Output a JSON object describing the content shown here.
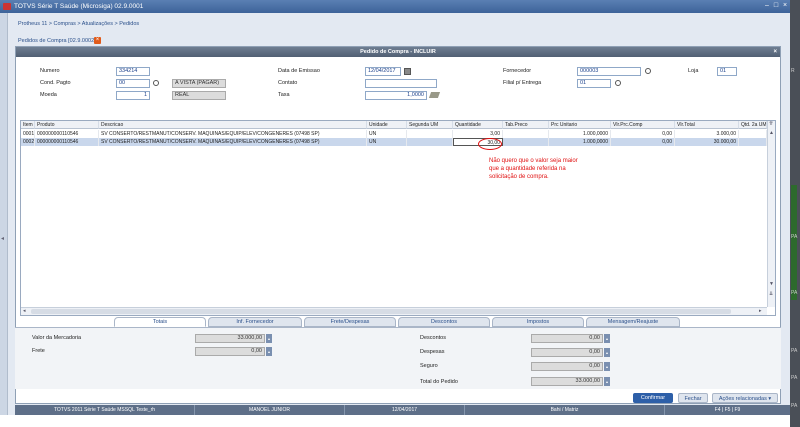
{
  "window": {
    "title": "TOTVS Série T Saúde (Microsiga) 02.9.0001"
  },
  "breadcrumb": "Protheus 11 > Compras > Atualizações > Pedidos",
  "page_title": "Pedidos de Compra [02.9.0002]",
  "dialog": {
    "title": "Pedido de Compra - INCLUIR"
  },
  "header": {
    "numero_label": "Numero",
    "numero": "334214",
    "cond_label": "Cond. Pagto",
    "cond": "00",
    "cond_desc": "A VISTA (PAGAR)",
    "moeda_label": "Moeda",
    "moeda": "1",
    "moeda_desc": "REAL",
    "data_label": "Data de Emissao",
    "data": "12/04/2017",
    "contato_label": "Contato",
    "contato": "",
    "taxa_label": "Taxa",
    "taxa": "1,0000",
    "fornecedor_label": "Fornecedor",
    "fornecedor": "000003",
    "loja_label": "Loja",
    "loja": "01",
    "filial_label": "Filial p/ Entrega",
    "filial": "01"
  },
  "grid": {
    "columns": [
      "Item",
      "Produto",
      "Descricao",
      "Unidade",
      "Segunda UM",
      "Quantidade",
      "Tab.Preco",
      "Prc Unitario",
      "Vlr.Prc.Comp",
      "Vlr.Total",
      "Qtd. 2a UM"
    ],
    "rows": [
      [
        "0001",
        "000000000110546",
        "SV CONSERTO/RESTMANUT/CONSERV. MAQUINAS/EQUIP/ELEV/CONGENERES (07498 SP)",
        "UN",
        "",
        "3,00",
        "",
        "1.000,0000",
        "0,00",
        "3.000,00",
        ""
      ],
      [
        "0002",
        "000000000110546",
        "SV CONSERTO/RESTMANUT/CONSERV. MAQUINAS/EQUIP/ELEV/CONGENERES (07498 SP)",
        "UN",
        "",
        "30,00",
        "",
        "1.000,0000",
        "0,00",
        "30.000,00",
        ""
      ]
    ]
  },
  "annotation": "Não quero que o valor seja maior que a quantidade referida na solicitação de compra.",
  "tabs": [
    "Totais",
    "Inf. Fornecedor",
    "Frete/Despesas",
    "Descontos",
    "Impostos",
    "Mensagem/Reajuste"
  ],
  "totals": {
    "valor_label": "Valor da Mercadoria",
    "valor": "33.000,00",
    "frete_label": "Frete",
    "frete": "0,00",
    "descontos_label": "Descontos",
    "descontos": "0,00",
    "despesas_label": "Despesas",
    "despesas": "0,00",
    "seguro_label": "Seguro",
    "seguro": "0,00",
    "total_label": "Total do Pedido",
    "total": "33.000,00"
  },
  "buttons": {
    "confirmar": "Confirmar",
    "fechar": "Fechar",
    "acoes": "Ações relacionadas"
  },
  "status": [
    "TOTVS 2011 Série T Saúde MSSQL Teste_rh",
    "MANOEL JUNIOR",
    "12/04/2017",
    "Bahi / Matriz",
    "F4 | F5 | F9"
  ],
  "right_labels": [
    "R",
    "PA",
    "PA",
    "PA",
    "PA",
    "PA"
  ],
  "colors": {
    "annotation": "#e01010",
    "titlebar": "#3d6399",
    "accent_button": "#2d5fa8"
  }
}
